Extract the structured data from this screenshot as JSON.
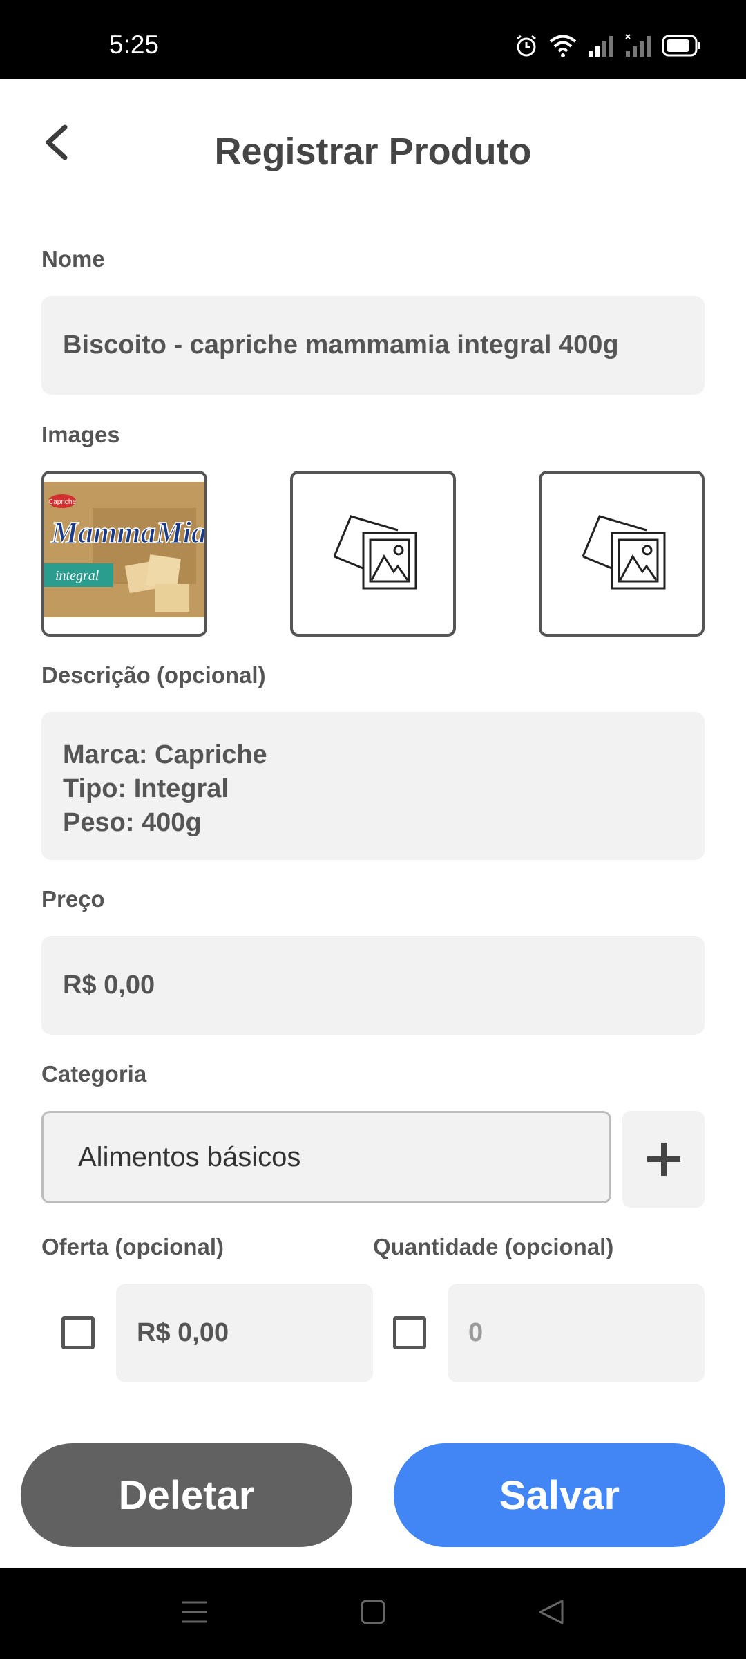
{
  "status": {
    "time": "5:25"
  },
  "header": {
    "title": "Registrar Produto"
  },
  "form": {
    "name_label": "Nome",
    "name_value": "Biscoito - capriche mammamia integral 400g",
    "images_label": "Images",
    "description_label": "Descrição (opcional)",
    "description_lines": [
      "Marca: Capriche",
      "Tipo: Integral",
      "Peso: 400g"
    ],
    "price_label": "Preço",
    "price_value": "R$ 0,00",
    "category_label": "Categoria",
    "category_value": "Alimentos básicos",
    "offer_label": "Oferta (opcional)",
    "offer_value": "R$ 0,00",
    "quantity_label": "Quantidade (opcional)",
    "quantity_placeholder": "0"
  },
  "product_image_text": {
    "brand_small": "Capriche",
    "brand": "MammaMia",
    "variant": "integral"
  },
  "actions": {
    "delete_label": "Deletar",
    "save_label": "Salvar"
  },
  "colors": {
    "save": "#4285f4",
    "delete": "#616161",
    "field_bg": "#f2f2f2"
  }
}
